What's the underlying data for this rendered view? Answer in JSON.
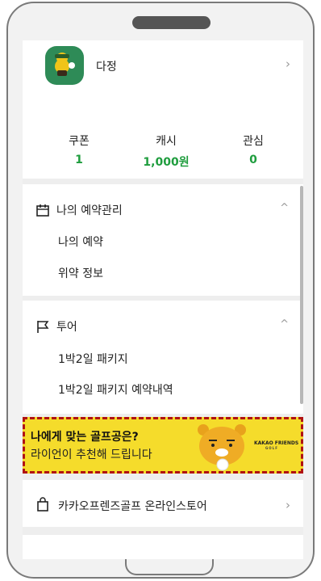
{
  "profile": {
    "name": "다정",
    "avatar_icon": "character-avatar-icon",
    "chevron": "›"
  },
  "stats": [
    {
      "label": "쿠폰",
      "value": "1"
    },
    {
      "label": "캐시",
      "value": "1,000원"
    },
    {
      "label": "관심",
      "value": "0"
    }
  ],
  "reservation": {
    "title": "나의 예약관리",
    "icon": "calendar-icon",
    "collapse": "^",
    "items": [
      "나의 예약",
      "위약 정보"
    ]
  },
  "tour": {
    "title": "투어",
    "icon": "flag-icon",
    "collapse": "^",
    "items": [
      "1박2일 패키지",
      "1박2일 패키지 예약내역"
    ]
  },
  "banner": {
    "title": "나에게 맞는 골프공은?",
    "subtitle": "라이언이 추천해 드립니다",
    "brand": "KAKAO FRIENDS",
    "brand_sub": "GOLF"
  },
  "store": {
    "label": "카카오프렌즈골프 온라인스토어",
    "icon": "shopping-bag-icon",
    "chevron": "›"
  },
  "colors": {
    "accent_green": "#1f9d3e",
    "banner_yellow": "#f5dc2b",
    "highlight_border": "#b01212"
  }
}
